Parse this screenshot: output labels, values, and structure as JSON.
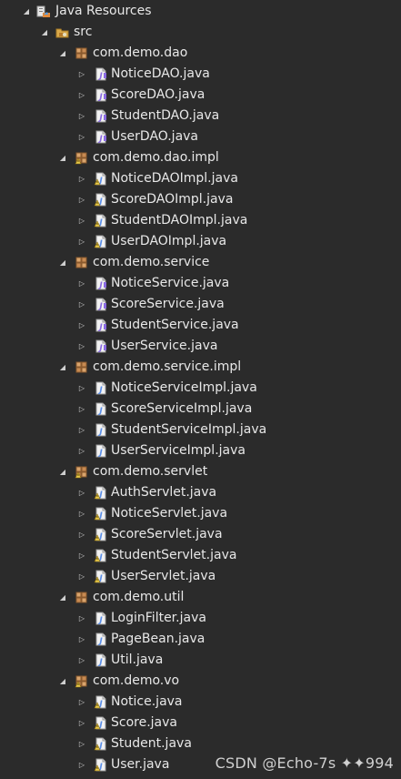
{
  "tree": {
    "root": {
      "label": "Java Resources",
      "icon": "java-resources-icon",
      "expanded": true
    },
    "src": {
      "label": "src",
      "icon": "source-folder-icon",
      "expanded": true
    },
    "packages": [
      {
        "label": "com.demo.dao",
        "icon": "package-icon",
        "expanded": true,
        "files": [
          {
            "label": "NoticeDAO.java",
            "icon": "java-interface-file-icon"
          },
          {
            "label": "ScoreDAO.java",
            "icon": "java-interface-file-icon"
          },
          {
            "label": "StudentDAO.java",
            "icon": "java-interface-file-icon"
          },
          {
            "label": "UserDAO.java",
            "icon": "java-interface-file-icon"
          }
        ]
      },
      {
        "label": "com.demo.dao.impl",
        "icon": "package-warning-icon",
        "expanded": true,
        "files": [
          {
            "label": "NoticeDAOImpl.java",
            "icon": "java-class-file-warning-icon"
          },
          {
            "label": "ScoreDAOImpl.java",
            "icon": "java-class-file-warning-icon"
          },
          {
            "label": "StudentDAOImpl.java",
            "icon": "java-class-file-warning-icon"
          },
          {
            "label": "UserDAOImpl.java",
            "icon": "java-class-file-warning-icon"
          }
        ]
      },
      {
        "label": "com.demo.service",
        "icon": "package-icon",
        "expanded": true,
        "files": [
          {
            "label": "NoticeService.java",
            "icon": "java-interface-file-icon"
          },
          {
            "label": "ScoreService.java",
            "icon": "java-interface-file-icon"
          },
          {
            "label": "StudentService.java",
            "icon": "java-interface-file-icon"
          },
          {
            "label": "UserService.java",
            "icon": "java-interface-file-icon"
          }
        ]
      },
      {
        "label": "com.demo.service.impl",
        "icon": "package-icon",
        "expanded": true,
        "files": [
          {
            "label": "NoticeServiceImpl.java",
            "icon": "java-class-file-icon"
          },
          {
            "label": "ScoreServiceImpl.java",
            "icon": "java-class-file-icon"
          },
          {
            "label": "StudentServiceImpl.java",
            "icon": "java-class-file-icon"
          },
          {
            "label": "UserServiceImpl.java",
            "icon": "java-class-file-icon"
          }
        ]
      },
      {
        "label": "com.demo.servlet",
        "icon": "package-warning-icon",
        "expanded": true,
        "files": [
          {
            "label": "AuthServlet.java",
            "icon": "java-class-file-warning-icon"
          },
          {
            "label": "NoticeServlet.java",
            "icon": "java-class-file-warning-icon"
          },
          {
            "label": "ScoreServlet.java",
            "icon": "java-class-file-warning-icon"
          },
          {
            "label": "StudentServlet.java",
            "icon": "java-class-file-warning-icon"
          },
          {
            "label": "UserServlet.java",
            "icon": "java-class-file-warning-icon"
          }
        ]
      },
      {
        "label": "com.demo.util",
        "icon": "package-icon",
        "expanded": true,
        "files": [
          {
            "label": "LoginFilter.java",
            "icon": "java-class-file-icon"
          },
          {
            "label": "PageBean.java",
            "icon": "java-class-file-icon"
          },
          {
            "label": "Util.java",
            "icon": "java-class-file-icon"
          }
        ]
      },
      {
        "label": "com.demo.vo",
        "icon": "package-warning-icon",
        "expanded": true,
        "files": [
          {
            "label": "Notice.java",
            "icon": "java-class-file-warning-icon"
          },
          {
            "label": "Score.java",
            "icon": "java-class-file-warning-icon"
          },
          {
            "label": "Student.java",
            "icon": "java-class-file-warning-icon"
          },
          {
            "label": "User.java",
            "icon": "java-class-file-warning-icon"
          }
        ]
      }
    ]
  },
  "watermark": "CSDN @Echo-7s ✦✦994",
  "colors": {
    "background": "#2b2b2b",
    "text": "#e8e8e8",
    "package_brown": "#c8956a",
    "java_blue": "#6fa6ff",
    "interface_purple": "#a58ad8",
    "warning_yellow": "#e6c84a"
  }
}
